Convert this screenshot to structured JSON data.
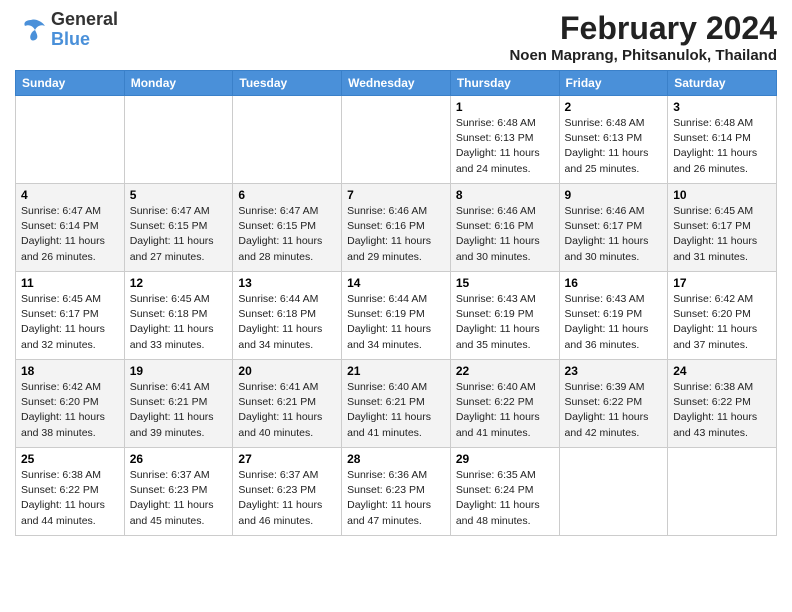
{
  "logo": {
    "line1": "General",
    "line2": "Blue"
  },
  "title": "February 2024",
  "location": "Noen Maprang, Phitsanulok, Thailand",
  "days_of_week": [
    "Sunday",
    "Monday",
    "Tuesday",
    "Wednesday",
    "Thursday",
    "Friday",
    "Saturday"
  ],
  "weeks": [
    [
      {
        "date": "",
        "info": ""
      },
      {
        "date": "",
        "info": ""
      },
      {
        "date": "",
        "info": ""
      },
      {
        "date": "",
        "info": ""
      },
      {
        "date": "1",
        "info": "Sunrise: 6:48 AM\nSunset: 6:13 PM\nDaylight: 11 hours and 24 minutes."
      },
      {
        "date": "2",
        "info": "Sunrise: 6:48 AM\nSunset: 6:13 PM\nDaylight: 11 hours and 25 minutes."
      },
      {
        "date": "3",
        "info": "Sunrise: 6:48 AM\nSunset: 6:14 PM\nDaylight: 11 hours and 26 minutes."
      }
    ],
    [
      {
        "date": "4",
        "info": "Sunrise: 6:47 AM\nSunset: 6:14 PM\nDaylight: 11 hours and 26 minutes."
      },
      {
        "date": "5",
        "info": "Sunrise: 6:47 AM\nSunset: 6:15 PM\nDaylight: 11 hours and 27 minutes."
      },
      {
        "date": "6",
        "info": "Sunrise: 6:47 AM\nSunset: 6:15 PM\nDaylight: 11 hours and 28 minutes."
      },
      {
        "date": "7",
        "info": "Sunrise: 6:46 AM\nSunset: 6:16 PM\nDaylight: 11 hours and 29 minutes."
      },
      {
        "date": "8",
        "info": "Sunrise: 6:46 AM\nSunset: 6:16 PM\nDaylight: 11 hours and 30 minutes."
      },
      {
        "date": "9",
        "info": "Sunrise: 6:46 AM\nSunset: 6:17 PM\nDaylight: 11 hours and 30 minutes."
      },
      {
        "date": "10",
        "info": "Sunrise: 6:45 AM\nSunset: 6:17 PM\nDaylight: 11 hours and 31 minutes."
      }
    ],
    [
      {
        "date": "11",
        "info": "Sunrise: 6:45 AM\nSunset: 6:17 PM\nDaylight: 11 hours and 32 minutes."
      },
      {
        "date": "12",
        "info": "Sunrise: 6:45 AM\nSunset: 6:18 PM\nDaylight: 11 hours and 33 minutes."
      },
      {
        "date": "13",
        "info": "Sunrise: 6:44 AM\nSunset: 6:18 PM\nDaylight: 11 hours and 34 minutes."
      },
      {
        "date": "14",
        "info": "Sunrise: 6:44 AM\nSunset: 6:19 PM\nDaylight: 11 hours and 34 minutes."
      },
      {
        "date": "15",
        "info": "Sunrise: 6:43 AM\nSunset: 6:19 PM\nDaylight: 11 hours and 35 minutes."
      },
      {
        "date": "16",
        "info": "Sunrise: 6:43 AM\nSunset: 6:19 PM\nDaylight: 11 hours and 36 minutes."
      },
      {
        "date": "17",
        "info": "Sunrise: 6:42 AM\nSunset: 6:20 PM\nDaylight: 11 hours and 37 minutes."
      }
    ],
    [
      {
        "date": "18",
        "info": "Sunrise: 6:42 AM\nSunset: 6:20 PM\nDaylight: 11 hours and 38 minutes."
      },
      {
        "date": "19",
        "info": "Sunrise: 6:41 AM\nSunset: 6:21 PM\nDaylight: 11 hours and 39 minutes."
      },
      {
        "date": "20",
        "info": "Sunrise: 6:41 AM\nSunset: 6:21 PM\nDaylight: 11 hours and 40 minutes."
      },
      {
        "date": "21",
        "info": "Sunrise: 6:40 AM\nSunset: 6:21 PM\nDaylight: 11 hours and 41 minutes."
      },
      {
        "date": "22",
        "info": "Sunrise: 6:40 AM\nSunset: 6:22 PM\nDaylight: 11 hours and 41 minutes."
      },
      {
        "date": "23",
        "info": "Sunrise: 6:39 AM\nSunset: 6:22 PM\nDaylight: 11 hours and 42 minutes."
      },
      {
        "date": "24",
        "info": "Sunrise: 6:38 AM\nSunset: 6:22 PM\nDaylight: 11 hours and 43 minutes."
      }
    ],
    [
      {
        "date": "25",
        "info": "Sunrise: 6:38 AM\nSunset: 6:22 PM\nDaylight: 11 hours and 44 minutes."
      },
      {
        "date": "26",
        "info": "Sunrise: 6:37 AM\nSunset: 6:23 PM\nDaylight: 11 hours and 45 minutes."
      },
      {
        "date": "27",
        "info": "Sunrise: 6:37 AM\nSunset: 6:23 PM\nDaylight: 11 hours and 46 minutes."
      },
      {
        "date": "28",
        "info": "Sunrise: 6:36 AM\nSunset: 6:23 PM\nDaylight: 11 hours and 47 minutes."
      },
      {
        "date": "29",
        "info": "Sunrise: 6:35 AM\nSunset: 6:24 PM\nDaylight: 11 hours and 48 minutes."
      },
      {
        "date": "",
        "info": ""
      },
      {
        "date": "",
        "info": ""
      }
    ]
  ]
}
